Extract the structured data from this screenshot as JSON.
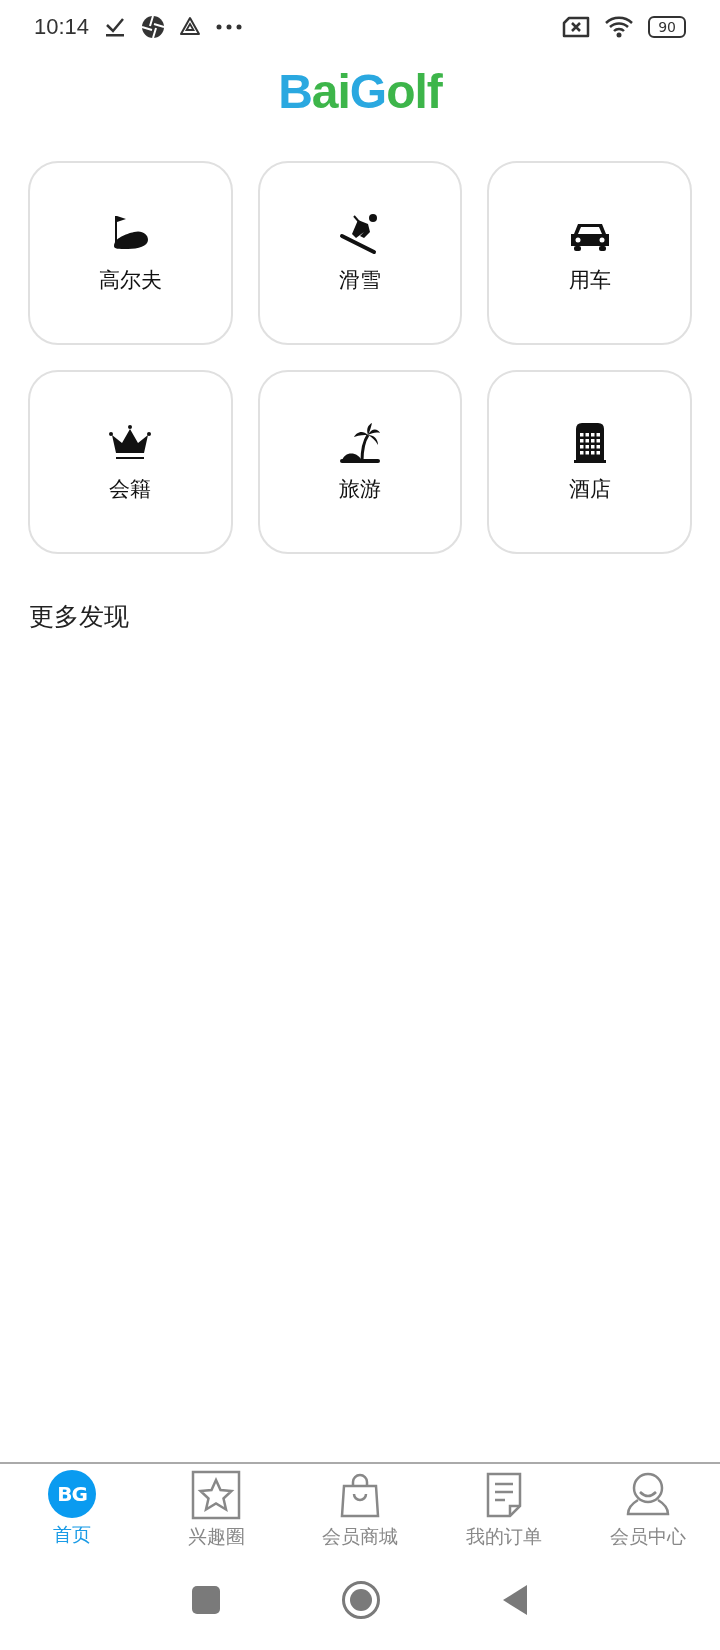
{
  "status_bar": {
    "time": "10:14",
    "battery": "90"
  },
  "logo": {
    "parts": [
      {
        "text": "B",
        "color": "#2aa8e0"
      },
      {
        "text": "ai",
        "color": "#3db54a"
      },
      {
        "text": "G",
        "color": "#2aa8e0"
      },
      {
        "text": "olf",
        "color": "#3db54a"
      }
    ]
  },
  "categories": [
    {
      "label": "高尔夫",
      "kind": "golf"
    },
    {
      "label": "滑雪",
      "kind": "ski"
    },
    {
      "label": "用车",
      "kind": "car"
    },
    {
      "label": "会籍",
      "kind": "crown"
    },
    {
      "label": "旅游",
      "kind": "island"
    },
    {
      "label": "酒店",
      "kind": "hotel"
    }
  ],
  "section_title": "更多发现",
  "tab_bar": [
    {
      "label": "首页",
      "kind": "badge",
      "badge_text": "BG",
      "selected": true
    },
    {
      "label": "兴趣圈",
      "kind": "star",
      "selected": false
    },
    {
      "label": "会员商城",
      "kind": "bag",
      "selected": false
    },
    {
      "label": "我的订单",
      "kind": "doc",
      "selected": false
    },
    {
      "label": "会员中心",
      "kind": "person",
      "selected": false
    }
  ]
}
